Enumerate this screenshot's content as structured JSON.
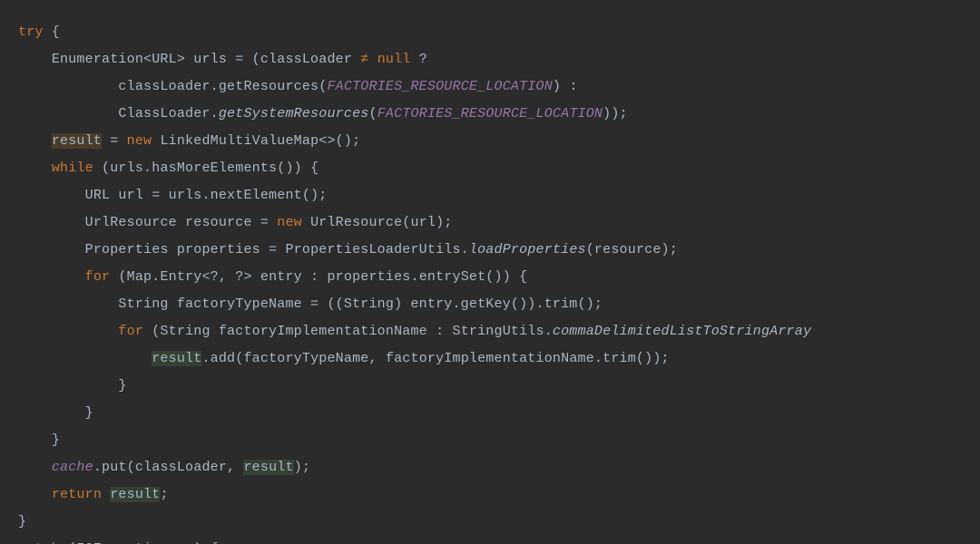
{
  "tokens": {
    "try": "try",
    "lbrace": "{",
    "rbrace": "}",
    "enum_decl": "Enumeration<URL> urls = (classLoader ",
    "ne": "≠",
    "null": "null",
    "q": "?",
    "cl_getres": "classLoader.getResources(",
    "frl": "FACTORIES_RESOURCE_LOCATION",
    "rparen_colon": ") :",
    "ClassLoader_dot": "ClassLoader.",
    "getSystemResources": "getSystemResources",
    "lparen": "(",
    "rrparen_semi": "));",
    "result": "result",
    "eq": "=",
    "new": "new",
    "lmvm": "LinkedMultiValueMap<>();",
    "while": "while",
    "while_cond": "(urls.hasMoreElements()) {",
    "url_line": "URL url = urls.nextElement();",
    "urlres_pre": "UrlResource resource = ",
    "urlres_post": "UrlResource(url);",
    "props_pre": "Properties properties = PropertiesLoaderUtils.",
    "loadProperties": "loadProperties",
    "props_post": "(resource);",
    "for": "for",
    "for1": "(Map.Entry<?, ?> entry : properties.entrySet()) {",
    "ftn": "String factoryTypeName = ((String) entry.getKey()).trim();",
    "for2_pre": "(String factoryImplementationName : StringUtils.",
    "commaDel": "commaDelimitedListToStringArray",
    "result_add": ".add(factoryTypeName, factoryImplementationName.trim());",
    "cache": "cache",
    "cache_put_pre": ".put(classLoader, ",
    "rparen_semi": ");",
    "return": "return",
    "semi": ";",
    "catch": "catch",
    "catch_rest": "(IOException ex) {"
  },
  "colors": {
    "background": "#2b2b2b",
    "default": "#a9b7c6",
    "keyword": "#cc7832",
    "static_field": "#9876aa",
    "highlight_write": "#4a3c2a",
    "highlight_read": "#344134"
  },
  "meta": {
    "language": "Java",
    "editor": "IntelliJ IDEA (Darcula theme)"
  }
}
